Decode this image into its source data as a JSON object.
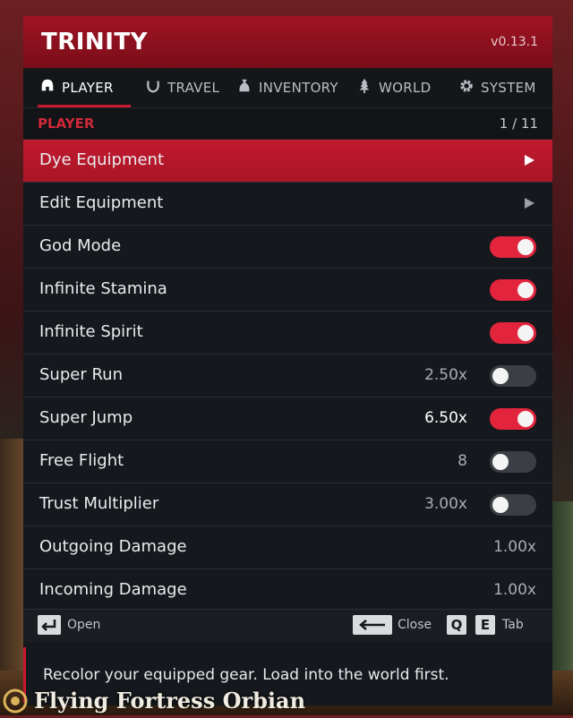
{
  "app": {
    "title": "TRINITY",
    "version": "v0.13.1"
  },
  "tabs": [
    {
      "label": "PLAYER",
      "icon": "helmet-icon",
      "active": true
    },
    {
      "label": "TRAVEL",
      "icon": "horseshoe-icon",
      "active": false
    },
    {
      "label": "INVENTORY",
      "icon": "sack-icon",
      "active": false
    },
    {
      "label": "WORLD",
      "icon": "tree-icon",
      "active": false
    },
    {
      "label": "SYSTEM",
      "icon": "gear-icon",
      "active": false
    }
  ],
  "section": {
    "name": "PLAYER",
    "page": "1 / 11"
  },
  "rows": [
    {
      "label": "Dye Equipment",
      "type": "submenu",
      "selected": true
    },
    {
      "label": "Edit Equipment",
      "type": "submenu",
      "selected": false
    },
    {
      "label": "God Mode",
      "type": "toggle",
      "on": true
    },
    {
      "label": "Infinite Stamina",
      "type": "toggle",
      "on": true
    },
    {
      "label": "Infinite Spirit",
      "type": "toggle",
      "on": true
    },
    {
      "label": "Super Run",
      "type": "toggle",
      "value": "2.50x",
      "on": false
    },
    {
      "label": "Super Jump",
      "type": "toggle",
      "value": "6.50x",
      "on": true
    },
    {
      "label": "Free Flight",
      "type": "toggle",
      "value": "8",
      "on": false
    },
    {
      "label": "Trust Multiplier",
      "type": "toggle",
      "value": "3.00x",
      "on": false
    },
    {
      "label": "Outgoing Damage",
      "type": "value",
      "value": "1.00x"
    },
    {
      "label": "Incoming Damage",
      "type": "value",
      "value": "1.00x"
    }
  ],
  "footer": {
    "open_label": "Open",
    "close_label": "Close",
    "tab_label": "Tab",
    "key_q": "Q",
    "key_e": "E"
  },
  "description": "Recolor your equipped gear. Load into the world first.",
  "location": "Flying Fortress Orbian",
  "colors": {
    "accent": "#c9182f",
    "toggle_on": "#e2253d",
    "toggle_off": "#3b3f45",
    "panel": "#15181c"
  }
}
